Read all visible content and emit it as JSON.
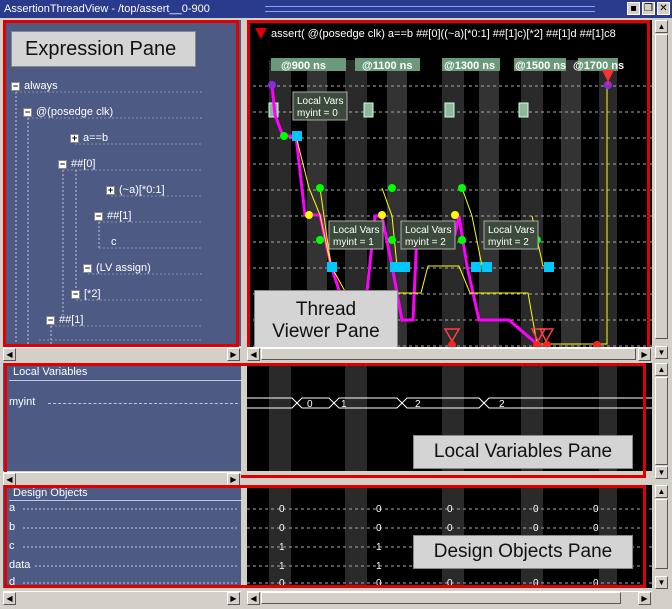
{
  "window": {
    "title": "AssertionThreadView - /top/assert__0-900"
  },
  "expression_pane": {
    "label": "Expression Pane",
    "tree": [
      {
        "label": "always",
        "box": "−"
      },
      {
        "label": "@(posedge clk)",
        "box": "−"
      },
      {
        "label": "a==b",
        "box": "+"
      },
      {
        "label": "##[0]",
        "box": "−"
      },
      {
        "label": "(~a)[*0:1]",
        "box": "+"
      },
      {
        "label": "##[1]",
        "box": "−"
      },
      {
        "label": "c",
        "box": ""
      },
      {
        "label": "(LV assign)",
        "box": "−"
      },
      {
        "label": "[*2]",
        "box": "−"
      },
      {
        "label": "##[1]",
        "box": "−"
      }
    ]
  },
  "thread_viewer": {
    "label_line1": "Thread",
    "label_line2": "Viewer Pane",
    "assertion_text": "assert( @(posedge clk) a==b ##[0]((~a)[*0:1] ##[1]c)[*2] ##[1]d ##[1]c8",
    "time_markers": [
      "@900 ns",
      "@1100 ns",
      "@1300 ns",
      "@1500 ns",
      "@1700 ns"
    ],
    "local_vars": [
      {
        "title": "Local Vars",
        "value": "myint = 0"
      },
      {
        "title": "Local Vars",
        "value": "myint = 1"
      },
      {
        "title": "Local Vars",
        "value": "myint = 2"
      },
      {
        "title": "Local Vars",
        "value": "myint = 2"
      }
    ]
  },
  "local_variables_pane": {
    "header": "Local Variables",
    "label": "Local Variables Pane",
    "rows": [
      {
        "name": "myint",
        "values": [
          "0",
          "1",
          "2",
          "2"
        ]
      }
    ]
  },
  "design_objects_pane": {
    "header": "Design Objects",
    "label": "Design Objects Pane",
    "rows": [
      {
        "name": "a",
        "values": [
          "0",
          "0",
          "0",
          "0",
          "0"
        ]
      },
      {
        "name": "b",
        "values": [
          "0",
          "0",
          "0",
          "0",
          "0"
        ]
      },
      {
        "name": "c",
        "values": [
          "1",
          "1",
          "1",
          "1",
          "1"
        ]
      },
      {
        "name": "data",
        "values": [
          "1",
          "1",
          "1",
          "1",
          "1"
        ]
      },
      {
        "name": "d",
        "values": [
          "0",
          "0",
          "0",
          "0",
          "0"
        ]
      }
    ]
  },
  "colors": {
    "accent_red": "#e00000",
    "magenta": "#ff00ff",
    "green": "#00ff00",
    "yellow": "#ffff00",
    "cyan": "#00c8ff",
    "pane_bg": "#4d5a84"
  }
}
